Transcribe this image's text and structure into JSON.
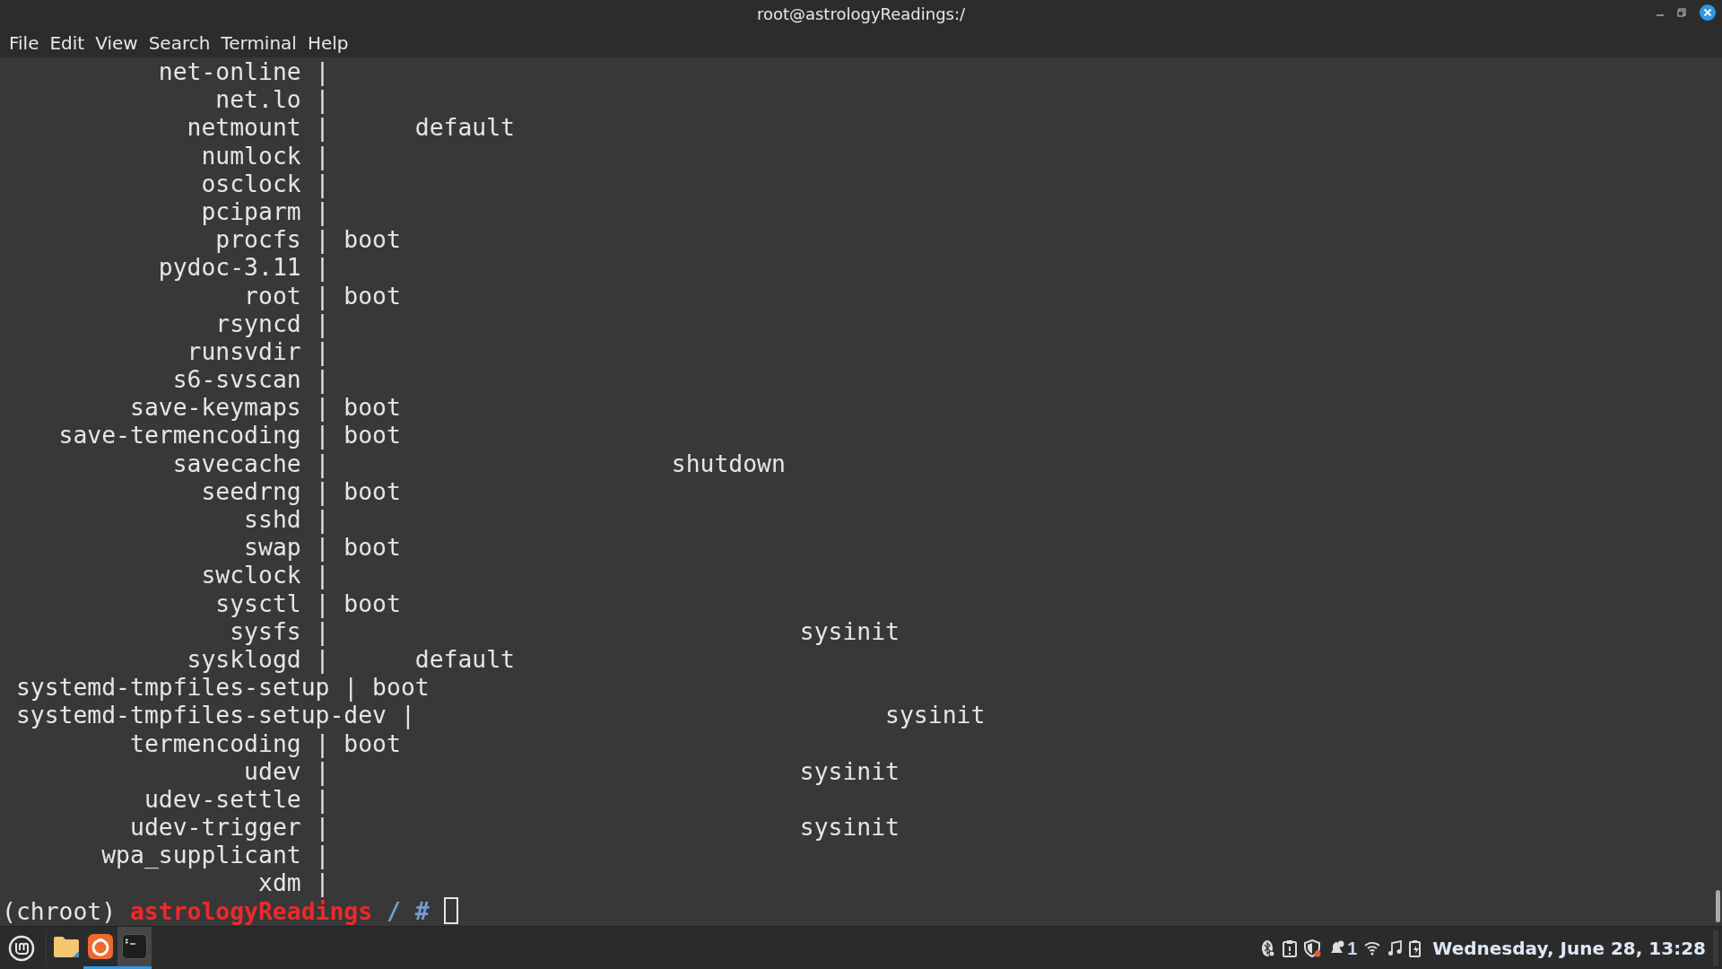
{
  "window": {
    "title": "root@astrologyReadings:/"
  },
  "menu": [
    "File",
    "Edit",
    "View",
    "Search",
    "Terminal",
    "Help"
  ],
  "terminal": {
    "lines": [
      "           net-online |",
      "               net.lo |",
      "             netmount |      default",
      "              numlock |",
      "              osclock |",
      "              pciparm |",
      "               procfs | boot",
      "           pydoc-3.11 |",
      "                 root | boot",
      "               rsyncd |",
      "             runsvdir |",
      "            s6-svscan |",
      "         save-keymaps | boot",
      "    save-termencoding | boot",
      "            savecache |                        shutdown",
      "              seedrng | boot",
      "                 sshd |",
      "                 swap | boot",
      "              swclock |",
      "               sysctl | boot",
      "                sysfs |                                 sysinit",
      "             sysklogd |      default",
      " systemd-tmpfiles-setup | boot",
      " systemd-tmpfiles-setup-dev |                                 sysinit",
      "         termencoding | boot",
      "                 udev |                                 sysinit",
      "          udev-settle |",
      "         udev-trigger |                                 sysinit",
      "       wpa_supplicant |",
      "                  xdm |"
    ],
    "prompt": {
      "prefix": "(chroot)",
      "host": "astrologyReadings",
      "path": "/",
      "symbol": "#"
    }
  },
  "taskbar": {
    "apps": [
      {
        "kind": "files",
        "running": false,
        "selected": false
      },
      {
        "kind": "browser",
        "running": true,
        "selected": false
      },
      {
        "kind": "terminal",
        "running": true,
        "selected": true
      }
    ],
    "notifications": "1",
    "clock": "Wednesday, June 28, 13:28"
  }
}
